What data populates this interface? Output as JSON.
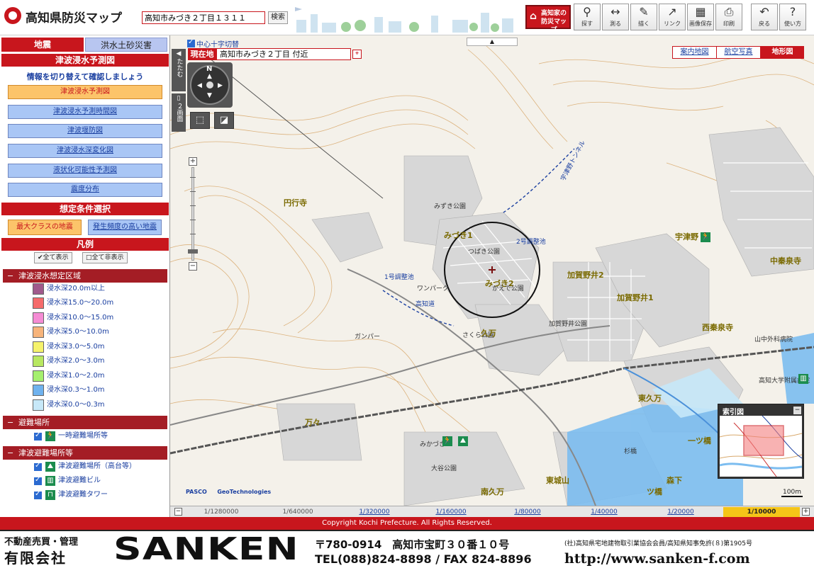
{
  "header": {
    "app_title": "高知県防災マップ",
    "search_value": "高知市みづき２丁目１３１１",
    "search_button": "検索",
    "home_button": "高知家の\n防災マップ",
    "tools": [
      {
        "label": "探す",
        "icon": "magnifier-icon"
      },
      {
        "label": "測る",
        "icon": "ruler-icon"
      },
      {
        "label": "描く",
        "icon": "draw-icon"
      },
      {
        "label": "リンク",
        "icon": "link-icon"
      },
      {
        "label": "画像保存",
        "icon": "save-image-icon"
      },
      {
        "label": "印刷",
        "icon": "print-icon"
      },
      {
        "label": "戻る",
        "icon": "back-icon"
      },
      {
        "label": "使い方",
        "icon": "help-icon"
      }
    ]
  },
  "left_panel": {
    "tabs": [
      "地震",
      "洪水土砂災害"
    ],
    "section_title": "津波浸水予測図",
    "hint": "情報を切り替えて確認しましょう",
    "map_buttons": [
      "津波浸水予測図",
      "津波浸水予測時間図",
      "津波堰防図",
      "津波浸水深変化図",
      "液状化可能性予測図",
      "震度分布"
    ],
    "conditions_title": "想定条件選択",
    "condition_buttons": [
      "最大クラスの地震",
      "発生頻度の高い地震"
    ],
    "legend_title": "凡例",
    "show_all": "全て表示",
    "hide_all": "全て非表示",
    "groups": [
      {
        "title": "津波浸水想定区域",
        "items": [
          {
            "label": "浸水深20.0m以上",
            "color": "#a05a8c"
          },
          {
            "label": "浸水深15.0～20.0m",
            "color": "#f56b6b"
          },
          {
            "label": "浸水深10.0～15.0m",
            "color": "#f58cd4"
          },
          {
            "label": "浸水深5.0～10.0m",
            "color": "#f7b47b"
          },
          {
            "label": "浸水深3.0～5.0m",
            "color": "#f5f26b"
          },
          {
            "label": "浸水深2.0～3.0m",
            "color": "#b8e860"
          },
          {
            "label": "浸水深1.0～2.0m",
            "color": "#a5f06e"
          },
          {
            "label": "浸水深0.3～1.0m",
            "color": "#6fb2ee"
          },
          {
            "label": "浸水深0.0～0.3m",
            "color": "#c7e8f8"
          }
        ]
      },
      {
        "title": "避難場所",
        "items": [
          {
            "label": "一時避難場所等"
          }
        ]
      },
      {
        "title": "津波避難場所等",
        "items": [
          {
            "label": "津波避難場所（高台等）"
          },
          {
            "label": "津波避難ビル"
          },
          {
            "label": "津波避難タワー"
          }
        ]
      }
    ]
  },
  "map": {
    "center_cross_label": "中心十字切替",
    "collapse_label": "たたむ",
    "split_label": "２画面",
    "location_label": "現在地",
    "location_value": "高知市みづき２丁目 付近",
    "basemaps": [
      "案内地図",
      "航空写真",
      "地形図"
    ],
    "selected_basemap": "地形図",
    "labels": [
      "円行寺",
      "みづき1",
      "みづき2",
      "つばき公園",
      "みずき公園",
      "かえで公園",
      "さくら公園",
      "加賀野井2",
      "加賀野井1",
      "加賀野井公園",
      "宇津野",
      "中秦泉寺",
      "西秦泉寺",
      "久万",
      "東久万",
      "万々",
      "みかづき",
      "大谷公園",
      "1号調整池",
      "2号調整池",
      "ワンパーク",
      "高知道",
      "宇津野トンネル",
      "山中外科病院",
      "高知大学附属病院",
      "一ツ橋",
      "南久万",
      "東城山",
      "杉橋",
      "森下",
      "ツ橋",
      "蔵前",
      "ガンパー"
    ],
    "index_map_title": "索引図",
    "attribution_pasco": "PASCO",
    "attribution_geo": "GeoTechnologies",
    "scale_bar": "100m"
  },
  "scales": [
    "1/1280000",
    "1/640000",
    "1/320000",
    "1/160000",
    "1/80000",
    "1/40000",
    "1/20000",
    "1/10000"
  ],
  "selected_scale": "1/10000",
  "copyright": "Copyright Kochi Prefecture. All Rights Reserved.",
  "footer": {
    "business": "不動産売買・管理",
    "company": "有限会社",
    "brand": "SANKEN",
    "address": "〒780-0914　高知市宝町３０番１０号",
    "tel": "TEL(088)824-8898 / FAX 824-8896",
    "license": "(社)高知県宅地建物取引業協会会員/高知県知事免許(８)第1905号",
    "url": "http://www.sanken-f.com"
  }
}
